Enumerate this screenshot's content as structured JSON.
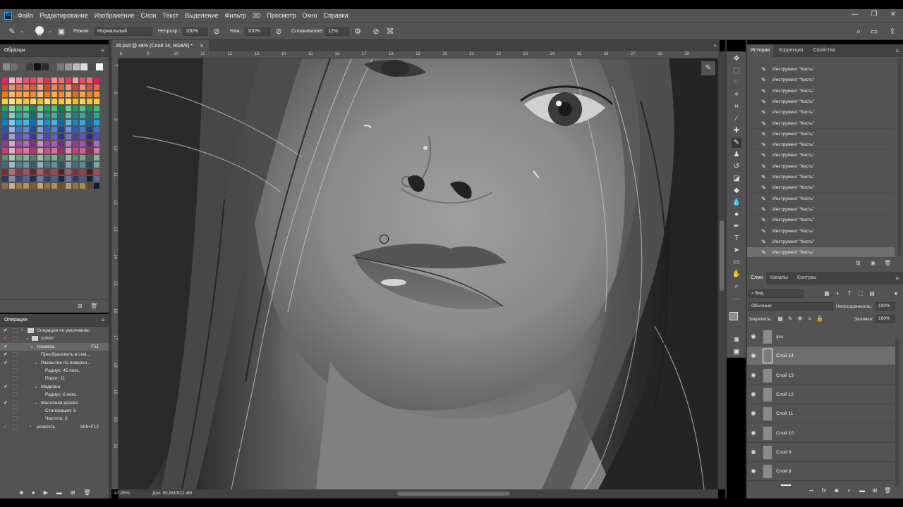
{
  "app": {
    "logo": "Ps"
  },
  "menu": [
    "Файл",
    "Редактирование",
    "Изображение",
    "Слои",
    "Текст",
    "Выделение",
    "Фильтр",
    "3D",
    "Просмотр",
    "Окно",
    "Справка"
  ],
  "window_controls": [
    "—",
    "❐",
    "✕"
  ],
  "options": {
    "brush_size": "45",
    "mode_label": "Режим:",
    "mode_value": "Нормальный",
    "opacity_label": "Непрозр.:",
    "opacity_value": "100%",
    "flow_label": "Наж.:",
    "flow_value": "100%",
    "smoothing_label": "Сглаживание:",
    "smoothing_value": "12%"
  },
  "swatches_panel": {
    "title": "Образцы",
    "grays": [
      "#8a8a8a",
      "#6f6f6f",
      "#5a5a5a",
      "#3e3e3e",
      "#111111",
      "#2a2a2a",
      "#555555",
      "#777777",
      "#999999",
      "#bbbbbb",
      "#dddddd",
      "#4b4b4b",
      "#ffffff"
    ],
    "colors": [
      "#e8236b",
      "#f5b5c8",
      "#f28ca3",
      "#e05575",
      "#e04a5a",
      "#f07474",
      "#d93a4a",
      "#f58f8f",
      "#ee6b6b",
      "#e83c5a",
      "#f4a0a0",
      "#e35262",
      "#f06a7a",
      "#e8195a",
      "#e53935",
      "#f28b82",
      "#e06a55",
      "#f07b57",
      "#e2563b",
      "#f4a37a",
      "#d44b2e",
      "#f57f5c",
      "#e9613c",
      "#f09a6f",
      "#d83c2f",
      "#f2896b",
      "#e74a3b",
      "#f06348",
      "#f57c00",
      "#f8b26a",
      "#f39a3a",
      "#f4a53f",
      "#f0882f",
      "#f9c07a",
      "#e67b1f",
      "#f7a852",
      "#ee8a2a",
      "#f5b063",
      "#e0701c",
      "#f3a04a",
      "#ea8025",
      "#f59432",
      "#f9d423",
      "#fbe28a",
      "#f7d24a",
      "#f5c831",
      "#f7dd63",
      "#f3c221",
      "#fae27a",
      "#f6cf3d",
      "#f4c52f",
      "#f9dc58",
      "#f0bd1d",
      "#f7d75a",
      "#f3c92a",
      "#f8d040",
      "#2e9e5b",
      "#8fd3a0",
      "#3fb56e",
      "#5cc285",
      "#1f8c4b",
      "#7ccf96",
      "#2aa263",
      "#4fbe7c",
      "#168048",
      "#69c78b",
      "#27985a",
      "#56c07f",
      "#1f8f52",
      "#46b874",
      "#00897b",
      "#7fcfc4",
      "#26a69a",
      "#4db6ac",
      "#00796b",
      "#66c2b6",
      "#19978a",
      "#3fb0a3",
      "#0a7e71",
      "#58bdb0",
      "#11897c",
      "#33a99b",
      "#077a6d",
      "#2fa597",
      "#0288d1",
      "#81c7f0",
      "#29a3e0",
      "#4fb3e8",
      "#0277bd",
      "#6cbcec",
      "#1a93d6",
      "#42aee6",
      "#0a6fa9",
      "#5ab5ea",
      "#1187c9",
      "#38a7e2",
      "#066ea3",
      "#2a9cdc",
      "#1e5bb8",
      "#8fb0e6",
      "#3a73cc",
      "#5a8bd6",
      "#1b4fa3",
      "#7aa0de",
      "#2c66c2",
      "#4f82d2",
      "#164796",
      "#6a95da",
      "#255dbb",
      "#4679ce",
      "#134190",
      "#3a70c9",
      "#4a3c9c",
      "#a79ad9",
      "#5e4fb4",
      "#7868c2",
      "#3f3290",
      "#8f82d0",
      "#5546a8",
      "#6f5fbd",
      "#372b85",
      "#8273c8",
      "#4c3fa0",
      "#6454b6",
      "#30247b",
      "#5a4bb0",
      "#8e3a9e",
      "#d3a0dc",
      "#a24bb2",
      "#b666c2",
      "#7d2f8c",
      "#c98ed2",
      "#9a44aa",
      "#af5cbd",
      "#702a7f",
      "#c07ccc",
      "#8f3da0",
      "#a452b6",
      "#652274",
      "#b06cc0",
      "#c2407e",
      "#eba7c8",
      "#d15790",
      "#dc74a4",
      "#b13670",
      "#e596bd",
      "#c94e89",
      "#d86a9d",
      "#a02e63",
      "#e08ab4",
      "#bf4582",
      "#d05e96",
      "#942858",
      "#cf7aaa",
      "#5f8f6f",
      "#a8c6b0",
      "#6f9f7e",
      "#86b094",
      "#547f62",
      "#9cbda6",
      "#68977a",
      "#7fa98c",
      "#4a7258",
      "#93b79e",
      "#5d8a6c",
      "#76a384",
      "#42674f",
      "#8ab29a",
      "#3e6f7c",
      "#9cbac2",
      "#4f808c",
      "#6c97a2",
      "#34606b",
      "#8fb0b8",
      "#49798a",
      "#6590a0",
      "#2d5560",
      "#84a8b2",
      "#42707e",
      "#5e8a98",
      "#264b56",
      "#7aa1ac",
      "#7a2a3a",
      "#b86a78",
      "#8e3646",
      "#a44e5e",
      "#6a2230",
      "#b15c6c",
      "#863044",
      "#9c4656",
      "#5e1c29",
      "#aa5666",
      "#7e2b3e",
      "#964051",
      "#531826",
      "#a04f60",
      "#2a3b5c",
      "#7d8aa8",
      "#38496e",
      "#55658c",
      "#222f4d",
      "#6c7a9c",
      "#33456a",
      "#4e5f86",
      "#1c2741",
      "#647397",
      "#2e3f63",
      "#485a80",
      "#182138",
      "#5c6c92",
      "#8a6d3b",
      "#c7ae82",
      "#9c7d48",
      "#b29460",
      "#7a5f31",
      "#bea477",
      "#967742",
      "#ad8f5a",
      "#6d5329",
      "#b89c6e",
      "#8f713d",
      "#a68a54",
      "#614823",
      "#131a3a"
    ],
    "footer_icons": [
      "new-swatch-icon",
      "trash-icon"
    ]
  },
  "operations_panel": {
    "title": "Операции",
    "items": [
      {
        "check": "✔",
        "red": false,
        "indent": 0,
        "arrow": "›",
        "folder": true,
        "label": "Операции по умолчанию",
        "shortcut": "",
        "selected": false
      },
      {
        "check": "✔",
        "red": true,
        "indent": 1,
        "arrow": "⌄",
        "folder": true,
        "label": "ocherr",
        "shortcut": "",
        "selected": false
      },
      {
        "check": "✔",
        "red": false,
        "indent": 2,
        "arrow": "⌄",
        "folder": false,
        "label": "тушевка",
        "shortcut": "F11",
        "selected": true
      },
      {
        "check": "✔",
        "red": false,
        "indent": 3,
        "arrow": "",
        "folder": false,
        "label": "Преобразовать в сма...",
        "shortcut": "",
        "selected": false
      },
      {
        "check": "✔",
        "red": false,
        "indent": 3,
        "arrow": "⌄",
        "folder": false,
        "label": "Размытие по поверхн...",
        "shortcut": "",
        "selected": false
      },
      {
        "check": "",
        "red": false,
        "indent": 4,
        "arrow": "",
        "folder": false,
        "label": "Радиус: 45 пикс.",
        "shortcut": "",
        "selected": false
      },
      {
        "check": "",
        "red": false,
        "indent": 4,
        "arrow": "",
        "folder": false,
        "label": "Порог: 11",
        "shortcut": "",
        "selected": false
      },
      {
        "check": "✔",
        "red": false,
        "indent": 3,
        "arrow": "⌄",
        "folder": false,
        "label": "Медиана",
        "shortcut": "",
        "selected": false
      },
      {
        "check": "",
        "red": false,
        "indent": 4,
        "arrow": "",
        "folder": false,
        "label": "Радиус: 6 пикс.",
        "shortcut": "",
        "selected": false
      },
      {
        "check": "✔",
        "red": false,
        "indent": 3,
        "arrow": "⌄",
        "folder": false,
        "label": "Масляная краска",
        "shortcut": "",
        "selected": false
      },
      {
        "check": "",
        "red": false,
        "indent": 4,
        "arrow": "",
        "folder": false,
        "label": "Стилизация: 3",
        "shortcut": "",
        "selected": false
      },
      {
        "check": "",
        "red": false,
        "indent": 4,
        "arrow": "",
        "folder": false,
        "label": "Чистота: 3",
        "shortcut": "",
        "selected": false
      },
      {
        "check": "✔",
        "red": true,
        "indent": 2,
        "arrow": "›",
        "folder": false,
        "label": "резкость",
        "shortcut": "Shft+F12",
        "selected": false
      }
    ],
    "footer_icons": [
      "stop-icon",
      "record-icon",
      "play-icon",
      "new-set-icon",
      "new-action-icon",
      "trash-icon"
    ]
  },
  "document": {
    "tab_title": "26.psd @ 48% (Слой 14, RGB/8) *",
    "zoom": "47,95%",
    "doc_size": "Док: 95,8M/822,4M",
    "ruler_h": [
      "8",
      "9",
      "10",
      "11",
      "12",
      "13",
      "14",
      "15",
      "16",
      "17",
      "18",
      "19",
      "20",
      "21",
      "22",
      "23",
      "24",
      "25",
      "26",
      "27",
      "28",
      "29"
    ],
    "ruler_v": [
      "7",
      "8",
      "9",
      "10",
      "11",
      "12",
      "13",
      "14",
      "15",
      "16",
      "17",
      "18",
      "19",
      "20",
      "21"
    ]
  },
  "history_panel": {
    "tabs": [
      "История",
      "Коррекция",
      "Свойства"
    ],
    "items": [
      "Инструмент \"Кисть\"",
      "Инструмент \"Кисть\"",
      "Инструмент \"Кисть\"",
      "Инструмент \"Кисть\"",
      "Инструмент \"Кисть\"",
      "Инструмент \"Кисть\"",
      "Инструмент \"Кисть\"",
      "Инструмент \"Кисть\"",
      "Инструмент \"Кисть\"",
      "Инструмент \"Кисть\"",
      "Инструмент \"Кисть\"",
      "Инструмент \"Кисть\"",
      "Инструмент \"Кисть\"",
      "Инструмент \"Кисть\"",
      "Инструмент \"Кисть\"",
      "Инструмент \"Кисть\"",
      "Инструмент \"Кисть\"",
      "Инструмент \"Кисть\""
    ]
  },
  "layers_panel": {
    "tabs": [
      "Слои",
      "Каналы",
      "Контуры"
    ],
    "filter_value": "Вид",
    "blend_mode": "Обычные",
    "opacity_label": "Непрозрачность:",
    "opacity_value": "100%",
    "lock_label": "Закрепить:",
    "fill_label": "Заливка:",
    "fill_value": "100%",
    "layers": [
      {
        "name": "ухо",
        "selected": false
      },
      {
        "name": "Слой 14",
        "selected": true
      },
      {
        "name": "Слой 13",
        "selected": false
      },
      {
        "name": "Слой 12",
        "selected": false
      },
      {
        "name": "Слой 11",
        "selected": false
      },
      {
        "name": "Слой 10",
        "selected": false
      },
      {
        "name": "Слой 9",
        "selected": false
      },
      {
        "name": "Слой 8",
        "selected": false
      }
    ]
  }
}
